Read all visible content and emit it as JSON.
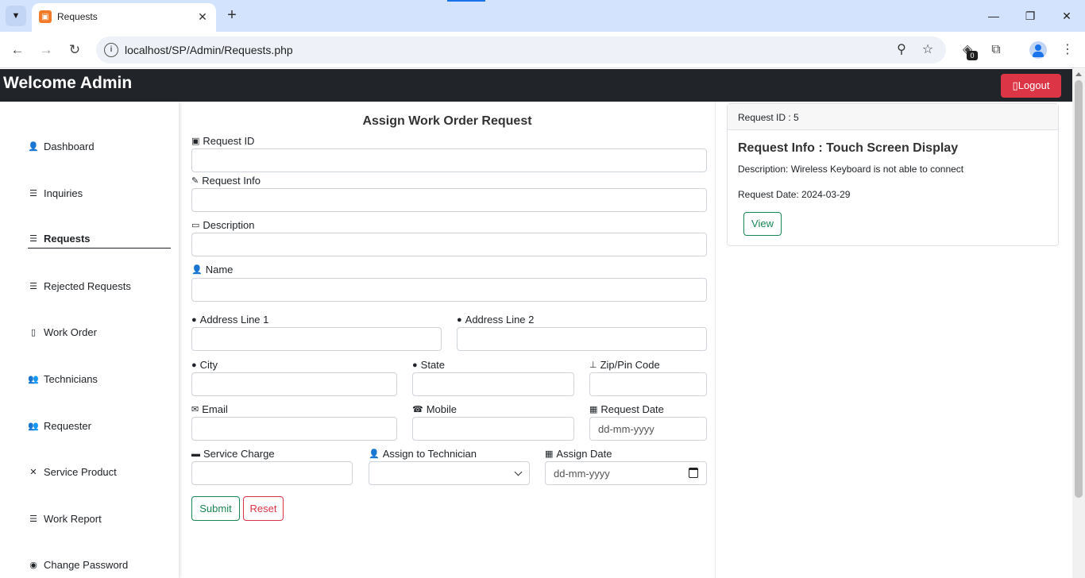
{
  "browser": {
    "tab_title": "Requests",
    "url": "localhost/SP/Admin/Requests.php",
    "extension_badge": "0",
    "icons": [
      "tab-search-icon",
      "favicon-icon",
      "close-icon",
      "new-tab-icon",
      "minimize-icon",
      "maximize-icon",
      "window-close-icon",
      "back-icon",
      "forward-icon",
      "reload-icon",
      "site-info-icon",
      "zoom-icon",
      "bookmark-star-icon",
      "extension-icon",
      "puzzle-icon",
      "profile-icon",
      "menu-icon"
    ]
  },
  "navbar": {
    "brand": "Welcome Admin",
    "logout_label": "Logout",
    "logout_color": "#dc3545"
  },
  "sidebar": {
    "items": [
      {
        "label": "Dashboard",
        "icon": "user-icon"
      },
      {
        "label": "Inquiries",
        "icon": "list-icon"
      },
      {
        "label": "Requests",
        "icon": "list-icon",
        "active": true
      },
      {
        "label": "Rejected Requests",
        "icon": "list-icon"
      },
      {
        "label": "Work Order",
        "icon": "clipboard-icon"
      },
      {
        "label": "Technicians",
        "icon": "users-icon"
      },
      {
        "label": "Requester",
        "icon": "user-group-icon"
      },
      {
        "label": "Service Product",
        "icon": "tools-icon"
      },
      {
        "label": "Work Report",
        "icon": "list-icon"
      },
      {
        "label": "Change Password",
        "icon": "eye-icon"
      }
    ]
  },
  "form": {
    "title": "Assign Work Order Request",
    "fields": {
      "request_id": {
        "label": "Request ID",
        "value": ""
      },
      "request_info": {
        "label": "Request Info",
        "value": ""
      },
      "description": {
        "label": "Description",
        "value": ""
      },
      "name": {
        "label": "Name",
        "value": ""
      },
      "address1": {
        "label": "Address Line 1",
        "value": ""
      },
      "address2": {
        "label": "Address Line 2",
        "value": ""
      },
      "city": {
        "label": "City",
        "value": ""
      },
      "state": {
        "label": "State",
        "value": ""
      },
      "zip": {
        "label": "Zip/Pin Code",
        "value": ""
      },
      "email": {
        "label": "Email",
        "value": ""
      },
      "mobile": {
        "label": "Mobile",
        "value": ""
      },
      "request_date": {
        "label": "Request Date",
        "value": "dd-mm-yyyy"
      },
      "service_charge": {
        "label": "Service Charge",
        "value": ""
      },
      "technician": {
        "label": "Assign to Technician",
        "value": ""
      },
      "assign_date": {
        "label": "Assign Date",
        "value": "dd-mm-yyyy"
      }
    },
    "submit_label": "Submit",
    "reset_label": "Reset",
    "submit_color": "#198754",
    "reset_color": "#dc3545"
  },
  "request_card": {
    "header": "Request ID : 5",
    "title": "Request Info : Touch Screen Display",
    "description": "Description: Wireless Keyboard is not able to connect",
    "request_date": "Request Date: 2024-03-29",
    "view_label": "View"
  }
}
